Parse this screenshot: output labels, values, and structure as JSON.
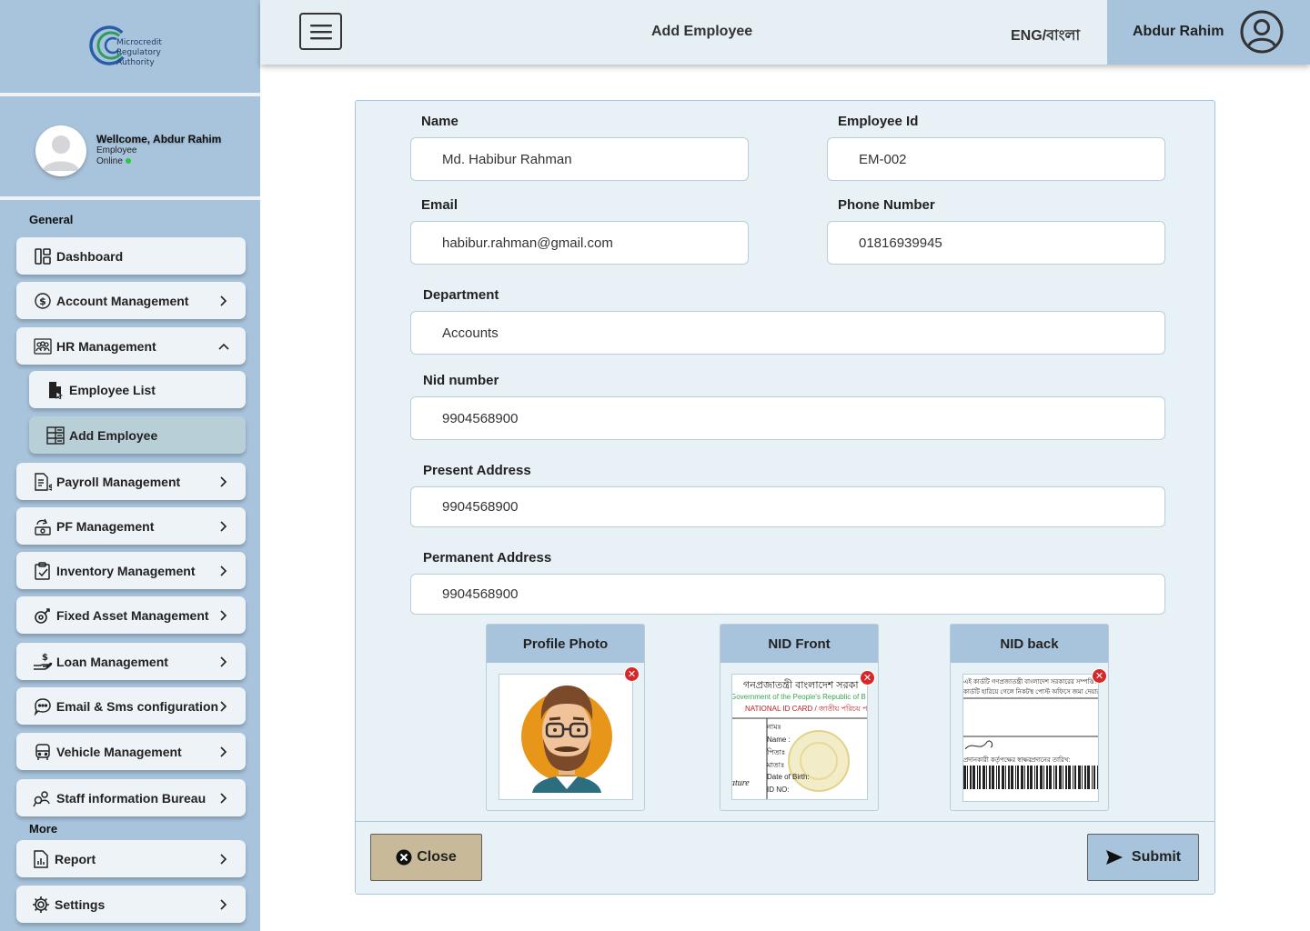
{
  "sidebar": {
    "logo_text_lines": [
      "Microcredit",
      "Regulatory",
      "Authority"
    ],
    "welcome": "Wellcome, Abdur Rahim",
    "role": "Employee",
    "status": "Online",
    "section_general": "General",
    "section_more": "More",
    "items": {
      "dashboard": "Dashboard",
      "account": "Account Management",
      "hr": "HR Management",
      "employee_list": "Employee List",
      "add_employee": "Add Employee",
      "payroll": "Payroll Management",
      "pf": "PF Management",
      "inventory": "Inventory Management",
      "fixed_asset": "Fixed Asset Management",
      "loan": "Loan Management",
      "email_sms": "Email & Sms configuration",
      "vehicle": "Vehicle Management",
      "staff_info": "Staff information Bureau",
      "report": "Report",
      "settings": "Settings"
    }
  },
  "topbar": {
    "title": "Add Employee",
    "language": "ENG/বাংলা",
    "user_name": "Abdur Rahim"
  },
  "form": {
    "name_label": "Name",
    "name_value": "Md. Habibur Rahman",
    "employee_id_label": "Employee Id",
    "employee_id_value": "EM-002",
    "email_label": "Email",
    "email_value": "habibur.rahman@gmail.com",
    "phone_label": "Phone Number",
    "phone_value": "01816939945",
    "department_label": "Department",
    "department_value": "Accounts",
    "nid_label": "Nid number",
    "nid_value": "9904568900",
    "present_address_label": "Present Address",
    "present_address_value": "9904568900",
    "permanent_address_label": "Permanent Address",
    "permanent_address_value": "9904568900",
    "uploads": {
      "profile_photo": "Profile Photo",
      "nid_front": "NID Front",
      "nid_back": "NID back"
    },
    "nid_front_text": {
      "line1": "গনপ্রজাতন্ত্রী বাংলাদেশ সরকা",
      "line2": "Government of the People's Republic of B",
      "line3": "NATIONAL ID CARD / জাতীয় পরিচয় প",
      "f1": "নামঃ",
      "f2": "Name :",
      "f3": "পিতাঃ",
      "f4": "মাতাঃ",
      "f5": "Date of Birth:",
      "f6": "ID NO:",
      "sig": "ature"
    },
    "nid_back_text": {
      "line1": "এই কার্ডটি গণপ্রজাতন্ত্রী বাংলাদেশ সরকারের সম্পত্তি। কার্ডটি ব্যবহারকারী",
      "line2": "কার্ডটি হারিয়ে গেলে নিকটস্থ পোস্ট অফিসে জমা দেয়ার জন্য অনুরোধ করা",
      "line3": "প্রদানকারী কর্তৃপক্ষের স্বাক্ষর",
      "line4": "প্রদানের তারিখ:"
    },
    "close_label": "Close",
    "submit_label": "Submit"
  },
  "colors": {
    "sidebar_bg": "#a8c4dc",
    "nav_item_bg": "#eef3f7",
    "nav_active_bg": "#b9cfd7",
    "form_bg": "#e8f1f5",
    "close_btn": "#c8b999",
    "submit_btn": "#a8c4dc",
    "online_dot": "#27c93f",
    "remove_red": "#d62828"
  }
}
